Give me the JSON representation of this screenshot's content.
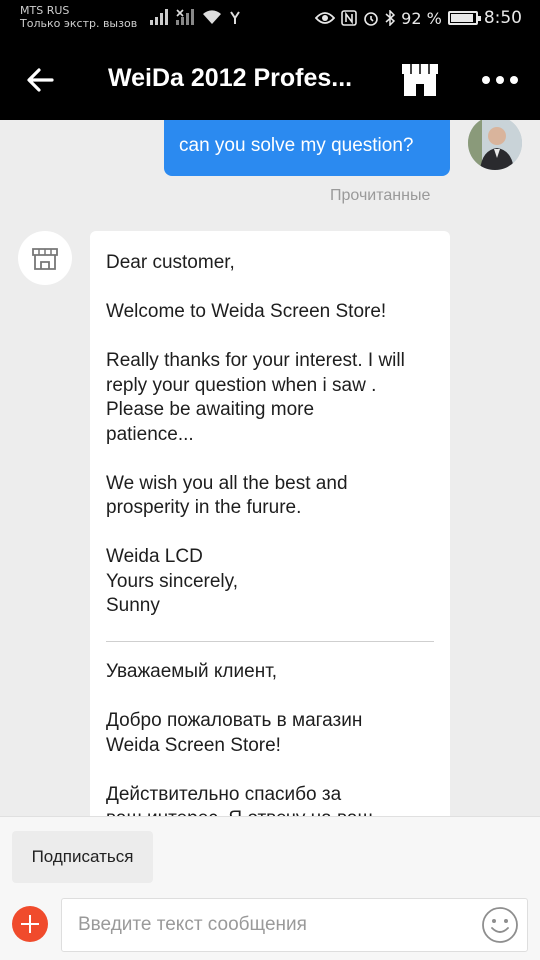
{
  "status_bar": {
    "carrier": "MTS RUS",
    "carrier_sub": "Только экстр. вызов",
    "battery_text": "92 %",
    "battery_level": 0.92,
    "time": "8:50"
  },
  "header": {
    "title": "WeiDa 2012 Profes..."
  },
  "chat": {
    "outgoing_message": "can you solve my question?",
    "read_status": "Прочитанные",
    "incoming": {
      "paragraphs": [
        "Dear customer,",
        "Welcome to Weida Screen Store!",
        "Really thanks for your interest. I will\nreply your question when i saw .\nPlease be awaiting more\npatience...",
        "We wish you all the best and\nprosperity in the furure.",
        "Weida LCD\nYours sincerely,\nSunny"
      ],
      "paragraphs_ru": [
        "Уважаемый клиент,",
        "Добро пожаловать в магазин\nWeida Screen Store!",
        "Действительно спасибо за\nваш интерес. Я отвечу на ваш"
      ]
    }
  },
  "bottom": {
    "subscribe_label": "Подписаться",
    "input_placeholder": "Введите текст сообщения"
  },
  "colors": {
    "accent_blue": "#2b8af0",
    "add_button_red": "#f04b2c",
    "header_bg": "#000000"
  }
}
